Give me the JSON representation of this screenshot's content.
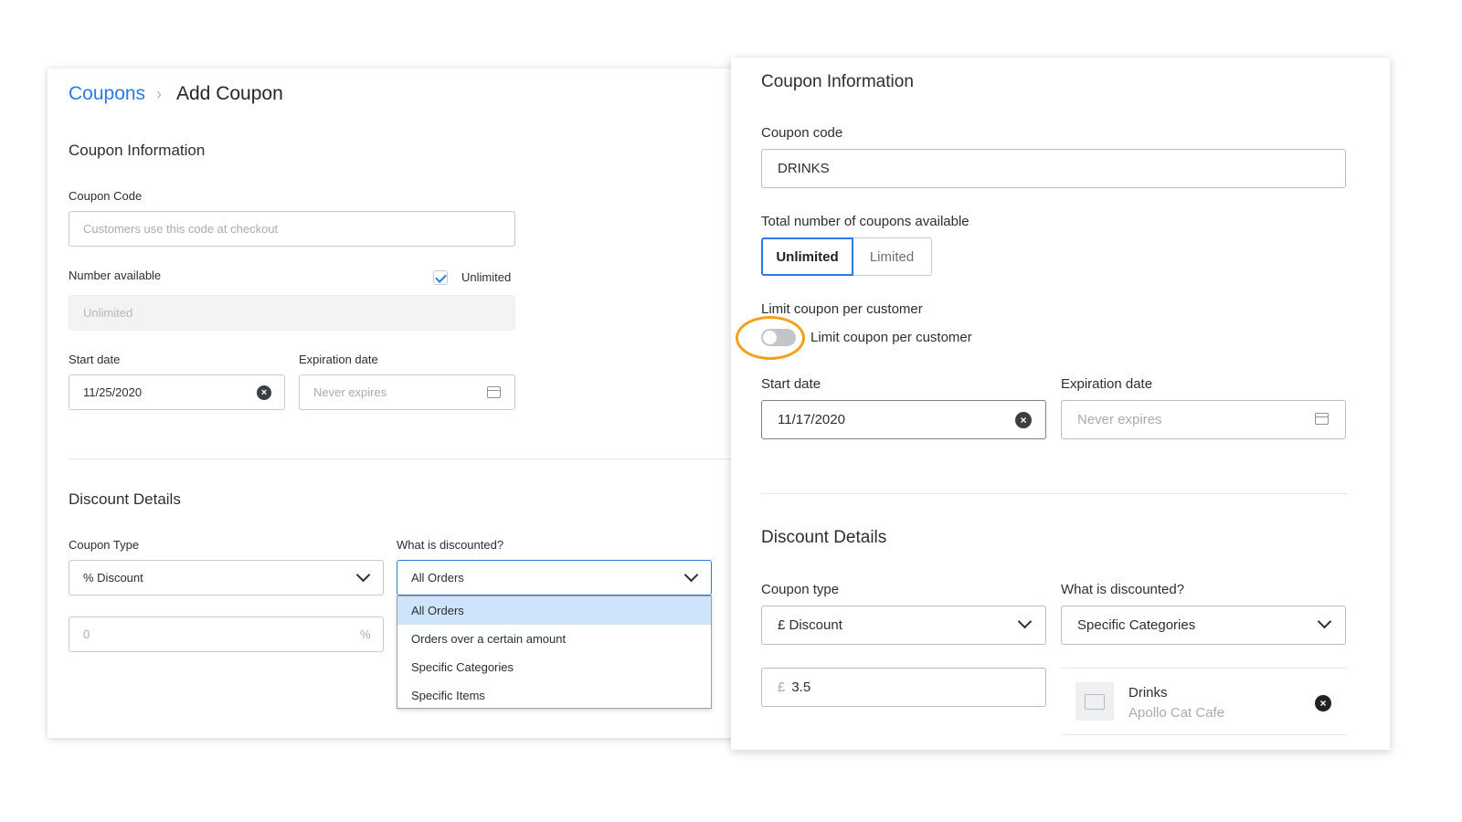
{
  "left": {
    "breadcrumb": {
      "parent": "Coupons",
      "current": "Add Coupon"
    },
    "coupon_info": {
      "title": "Coupon Information",
      "code_label": "Coupon Code",
      "code_placeholder": "Customers use this code at checkout",
      "number_label": "Number available",
      "unlimited_checkbox_label": "Unlimited",
      "unlimited_checked": true,
      "number_placeholder": "Unlimited",
      "start_label": "Start date",
      "start_value": "11/25/2020",
      "exp_label": "Expiration date",
      "exp_placeholder": "Never expires"
    },
    "discount": {
      "title": "Discount Details",
      "type_label": "Coupon Type",
      "type_value": "% Discount",
      "what_label": "What is discounted?",
      "what_value": "All Orders",
      "amount_placeholder": "0",
      "amount_suffix": "%",
      "options": [
        "All Orders",
        "Orders over a certain amount",
        "Specific Categories",
        "Specific Items"
      ],
      "selected_option": "All Orders"
    }
  },
  "right": {
    "coupon_info": {
      "title": "Coupon Information",
      "code_label": "Coupon code",
      "code_value": "DRINKS",
      "total_label": "Total number of coupons available",
      "seg_unlimited": "Unlimited",
      "seg_limited": "Limited",
      "seg_selected": "Unlimited",
      "limit_label": "Limit coupon per customer",
      "limit_toggle_label": "Limit coupon per customer",
      "limit_on": false,
      "start_label": "Start date",
      "start_value": "11/17/2020",
      "exp_label": "Expiration date",
      "exp_placeholder": "Never expires"
    },
    "discount": {
      "title": "Discount Details",
      "type_label": "Coupon type",
      "type_value": "£ Discount",
      "what_label": "What is discounted?",
      "what_value": "Specific Categories",
      "amount_prefix": "£",
      "amount_value": "3.5",
      "category_name": "Drinks",
      "category_sub": "Apollo Cat Cafe"
    }
  },
  "colors": {
    "accent": "#2b7be5",
    "highlight": "#f5a01d",
    "selected_option_bg": "#cde4fb"
  },
  "icons": [
    "chevron-right-icon",
    "check-icon",
    "clear-icon",
    "calendar-icon",
    "chevron-down-icon",
    "image-placeholder-icon"
  ]
}
